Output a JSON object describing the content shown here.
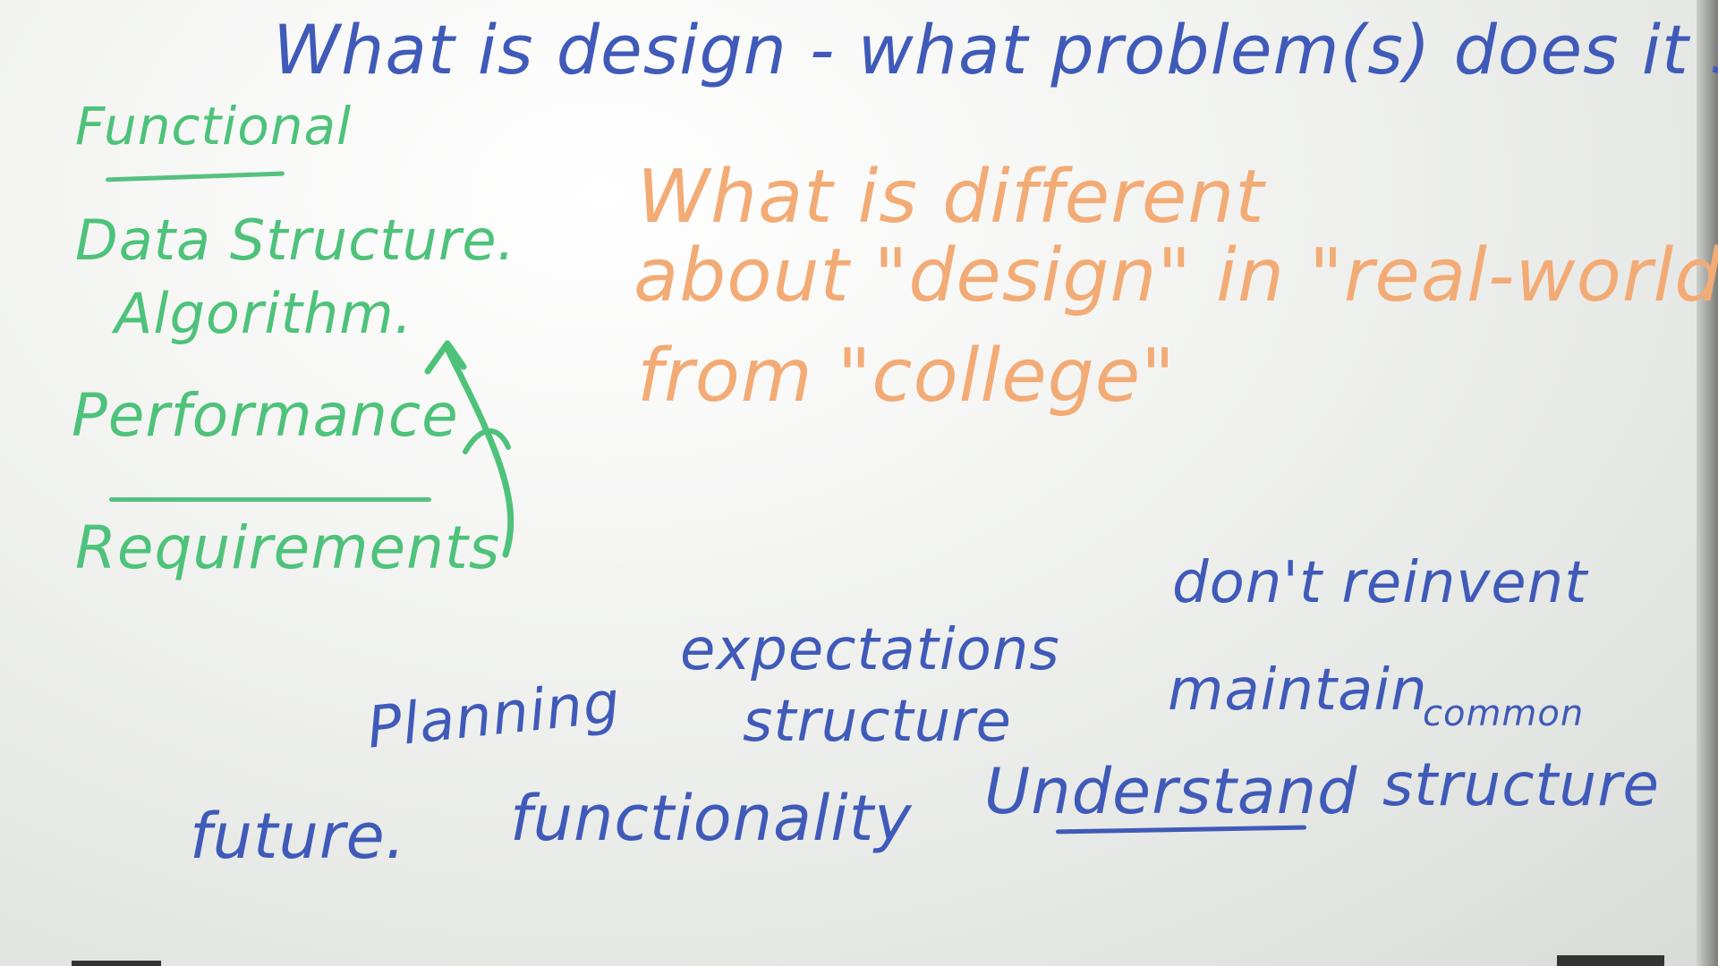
{
  "title": "What is design - what problem(s) does it solve",
  "question": {
    "line1": "What is different",
    "line2": "about \"design\" in \"real-world\"",
    "line3": "from \"college\""
  },
  "left_column": {
    "header": "Functional",
    "items": [
      "Data Structure.",
      "Algorithm.",
      "Performance"
    ],
    "footer": "Requirements"
  },
  "bottom_words": {
    "planning": "Planning",
    "expectations": "expectations",
    "structure": "structure",
    "dont_reinvent": "don't reinvent",
    "maintain": "maintain",
    "common": "common",
    "structure2": "structure",
    "future": "future.",
    "functionality": "functionality",
    "understand": "Understand"
  },
  "colors": {
    "blue_marker": "#3f5ab8",
    "green_marker": "#4ec27a",
    "orange_marker": "#f3ab76",
    "board": "#f2f3f1"
  }
}
